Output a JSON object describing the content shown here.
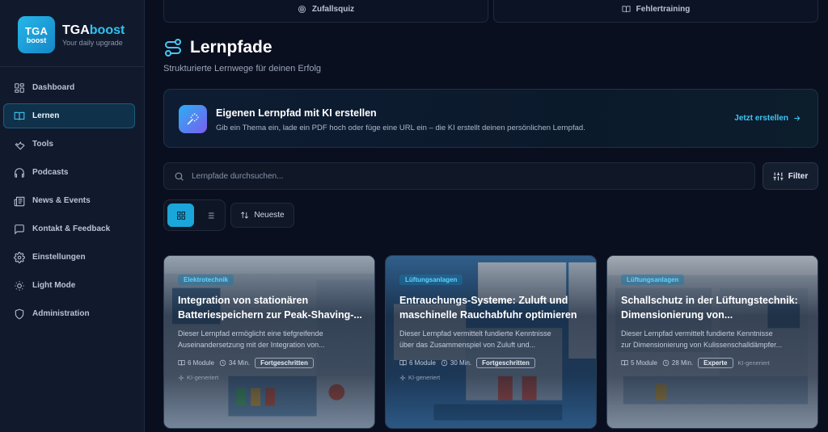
{
  "brand": {
    "logo_line1": "TGA",
    "logo_line2": "boost",
    "name_part1": "TGA",
    "name_part2": "boost",
    "tagline": "Your daily upgrade"
  },
  "sidebar": {
    "items": [
      {
        "label": "Dashboard",
        "icon": "dashboard-icon"
      },
      {
        "label": "Lernen",
        "icon": "book-icon",
        "active": true
      },
      {
        "label": "Tools",
        "icon": "wrench-icon"
      },
      {
        "label": "Podcasts",
        "icon": "headphones-icon"
      },
      {
        "label": "News & Events",
        "icon": "newspaper-icon"
      },
      {
        "label": "Kontakt & Feedback",
        "icon": "message-icon"
      },
      {
        "label": "Einstellungen",
        "icon": "gear-icon"
      },
      {
        "label": "Light Mode",
        "icon": "sun-icon"
      },
      {
        "label": "Administration",
        "icon": "shield-icon"
      }
    ]
  },
  "top_buttons": {
    "quiz": "Zufallsquiz",
    "errors": "Fehlertraining"
  },
  "page": {
    "title": "Lernpfade",
    "subtitle": "Strukturierte Lernwege für deinen Erfolg"
  },
  "ai_card": {
    "title": "Eigenen Lernpfad mit KI erstellen",
    "description": "Gib ein Thema ein, lade ein PDF hoch oder füge eine URL ein – die KI erstellt deinen persönlichen Lernpfad.",
    "cta": "Jetzt erstellen"
  },
  "search": {
    "placeholder": "Lernpfade durchsuchen..."
  },
  "filter_label": "Filter",
  "sort_label": "Neueste",
  "cards": [
    {
      "tag": "Elektrotechnik",
      "title": "Integration von stationären\nBatteriespeichern zur Peak-Shaving-...",
      "description": "Dieser Lernpfad ermöglicht eine tiefgreifende\nAuseinandersetzung mit der Integration von...",
      "modules": "6 Module",
      "duration": "34 Min.",
      "level": "Fortgeschritten",
      "generated": "KI-generiert"
    },
    {
      "tag": "Lüftungsanlagen",
      "title": "Entrauchungs-Systeme: Zuluft und\nmaschinelle Rauchabfuhr optimieren",
      "description": "Dieser Lernpfad vermittelt fundierte Kenntnisse\nüber das Zusammenspiel von Zuluft und...",
      "modules": "6 Module",
      "duration": "30 Min.",
      "level": "Fortgeschritten",
      "generated": "KI-generiert"
    },
    {
      "tag": "Lüftungsanlagen",
      "title": "Schallschutz in der Lüftungstechnik:\nDimensionierung von...",
      "description": "Dieser Lernpfad vermittelt fundierte Kenntnisse\nzur Dimensionierung von Kulissenschalldämpfer...",
      "modules": "5 Module",
      "duration": "28 Min.",
      "level": "Experte",
      "generated": "KI-generiert"
    }
  ],
  "colors": {
    "accent": "#2fc3f2",
    "background": "#0a0f1f",
    "sidebar": "#111a2c"
  }
}
